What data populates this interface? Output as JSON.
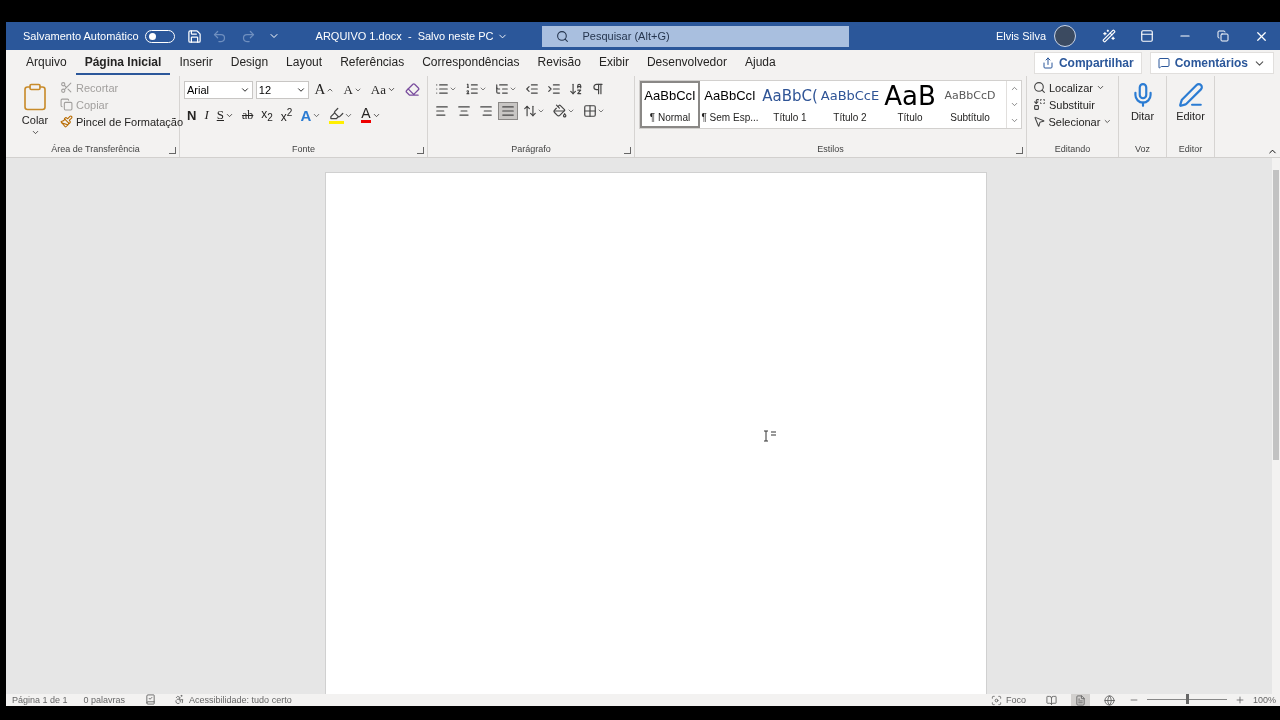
{
  "title_bar": {
    "autosave_label": "Salvamento Automático",
    "autosave_on": false,
    "undo_disabled": true,
    "redo_disabled": true,
    "document_title": "ARQUIVO 1.docx  -  Salvo neste PC",
    "search": {
      "placeholder": "Pesquisar (Alt+G)"
    },
    "user_name": "Elvis Silva"
  },
  "tabs": [
    {
      "label": "Arquivo",
      "selected": false
    },
    {
      "label": "Página Inicial",
      "selected": true
    },
    {
      "label": "Inserir",
      "selected": false
    },
    {
      "label": "Design",
      "selected": false
    },
    {
      "label": "Layout",
      "selected": false
    },
    {
      "label": "Referências",
      "selected": false
    },
    {
      "label": "Correspondências",
      "selected": false
    },
    {
      "label": "Revisão",
      "selected": false
    },
    {
      "label": "Exibir",
      "selected": false
    },
    {
      "label": "Desenvolvedor",
      "selected": false
    },
    {
      "label": "Ajuda",
      "selected": false
    }
  ],
  "share_button": "Compartilhar",
  "comments_button": "Comentários",
  "clipboard": {
    "title": "Área de Transferência",
    "paste": "Colar",
    "items": [
      {
        "kind": "cut",
        "label": "Recortar",
        "disabled": true
      },
      {
        "kind": "copy",
        "label": "Copiar",
        "disabled": true
      },
      {
        "kind": "painter",
        "label": "Pincel de Formatação",
        "disabled": false
      }
    ]
  },
  "font": {
    "title": "Fonte",
    "font_name": "Arial",
    "font_size": "12",
    "row1": [
      {
        "kind": "grow",
        "label": "A"
      },
      {
        "kind": "shrink",
        "label": "A"
      },
      {
        "kind": "case",
        "label": "Aa"
      },
      {
        "kind": "clear"
      }
    ],
    "row2": [
      {
        "kind": "bold",
        "label": "N"
      },
      {
        "kind": "italic",
        "label": "I"
      },
      {
        "kind": "underline",
        "label": "S"
      },
      {
        "kind": "strike",
        "label": "ab"
      },
      {
        "kind": "sub",
        "label": "x$_{2}$"
      },
      {
        "kind": "sup",
        "label": "x$^{2}$"
      },
      {
        "kind": "effects",
        "label": "A"
      },
      {
        "kind": "highlight"
      },
      {
        "kind": "color",
        "label": "A"
      }
    ]
  },
  "paragraph": {
    "title": "Parágrafo",
    "row1": [
      {
        "kind": "bullets",
        "selected": false
      },
      {
        "kind": "numbering",
        "selected": false
      },
      {
        "kind": "multilevel",
        "selected": false
      },
      {
        "kind": "outdent",
        "selected": false
      },
      {
        "kind": "indent",
        "selected": false
      },
      {
        "kind": "sort",
        "selected": false
      },
      {
        "kind": "marks",
        "selected": false
      }
    ],
    "row2": [
      {
        "kind": "left",
        "selected": false
      },
      {
        "kind": "center",
        "selected": false
      },
      {
        "kind": "right",
        "selected": false
      },
      {
        "kind": "justify",
        "selected": true
      },
      {
        "kind": "spacing",
        "selected": false
      },
      {
        "kind": "shading",
        "selected": false
      },
      {
        "kind": "borders",
        "selected": false
      }
    ]
  },
  "styles": {
    "title": "Estilos",
    "items": [
      {
        "kind": "normal",
        "preview": "AaBbCcI",
        "name": "¶ Normal",
        "selected": true
      },
      {
        "kind": "nospacing",
        "preview": "AaBbCcI",
        "name": "¶ Sem Esp...",
        "selected": false
      },
      {
        "kind": "heading1",
        "preview": "AaBbC(",
        "name": "Título 1",
        "selected": false
      },
      {
        "kind": "heading2",
        "preview": "AaBbCcE",
        "name": "Título 2",
        "selected": false
      },
      {
        "kind": "title",
        "preview": "AaB",
        "name": "Título",
        "selected": false
      },
      {
        "kind": "subtitle",
        "preview": "AaBbCcD",
        "name": "Subtítulo",
        "selected": false
      }
    ]
  },
  "editing": {
    "title": "Editando",
    "items": [
      {
        "kind": "find",
        "label": "Localizar"
      },
      {
        "kind": "replace",
        "label": "Substituir"
      },
      {
        "kind": "select",
        "label": "Selecionar"
      }
    ]
  },
  "voice": {
    "title": "Voz",
    "button": "Ditar"
  },
  "editor": {
    "title": "Editor",
    "button": "Editor"
  },
  "status_bar": {
    "page": "Página 1 de 1",
    "words": "0 palavras",
    "accessibility": "Acessibilidade: tudo certo",
    "focus": "Foco",
    "views": [
      {
        "kind": "read",
        "selected": false
      },
      {
        "kind": "print",
        "selected": true
      },
      {
        "kind": "web",
        "selected": false
      }
    ],
    "zoom_slider": {
      "level": 0.5
    },
    "zoom": "100%"
  }
}
